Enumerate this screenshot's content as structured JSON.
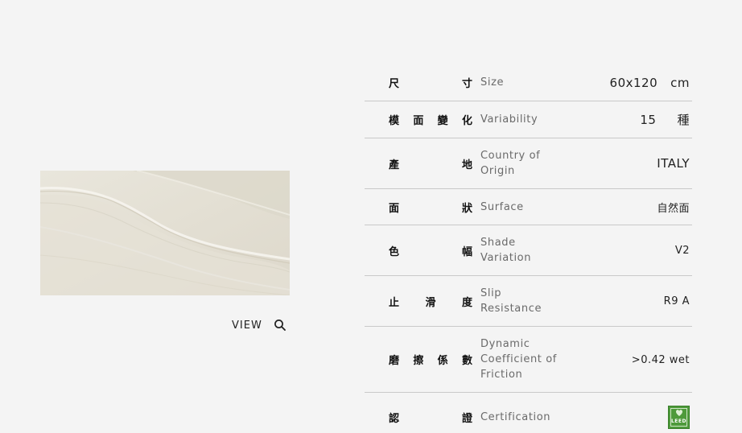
{
  "colors": {
    "background": "#f4f4f4",
    "divider": "#c9c9c9",
    "label_grey": "#6a6a6a",
    "leed_green": "#4e9a3b"
  },
  "product": {
    "view_label": "VIEW",
    "view_icon": "search-icon"
  },
  "specs": [
    {
      "zh": [
        "尺",
        "寸"
      ],
      "en": "Size",
      "value_main": "60x120",
      "value_unit": "cm"
    },
    {
      "zh": [
        "模",
        "面",
        "變",
        "化"
      ],
      "en": "Variability",
      "value_main": "15",
      "value_unit": "種"
    },
    {
      "zh": [
        "產",
        "地"
      ],
      "en": "Country of\nOrigin",
      "value": "ITALY"
    },
    {
      "zh": [
        "面",
        "狀"
      ],
      "en": "Surface",
      "value": "自然面"
    },
    {
      "zh": [
        "色",
        "幅"
      ],
      "en": "Shade\nVariation",
      "value": "V2"
    },
    {
      "zh": [
        "止",
        "滑",
        "度"
      ],
      "en": "Slip\nResistance",
      "value": "R9 A"
    },
    {
      "zh": [
        "磨",
        "擦",
        "係",
        "數"
      ],
      "en": "Dynamic\nCoefficient of\nFriction",
      "value": ">0.42 wet"
    },
    {
      "zh": [
        "認",
        "證"
      ],
      "en": "Certification",
      "badge_icon": "leed-badge-icon",
      "badge_text": "LEED"
    }
  ]
}
